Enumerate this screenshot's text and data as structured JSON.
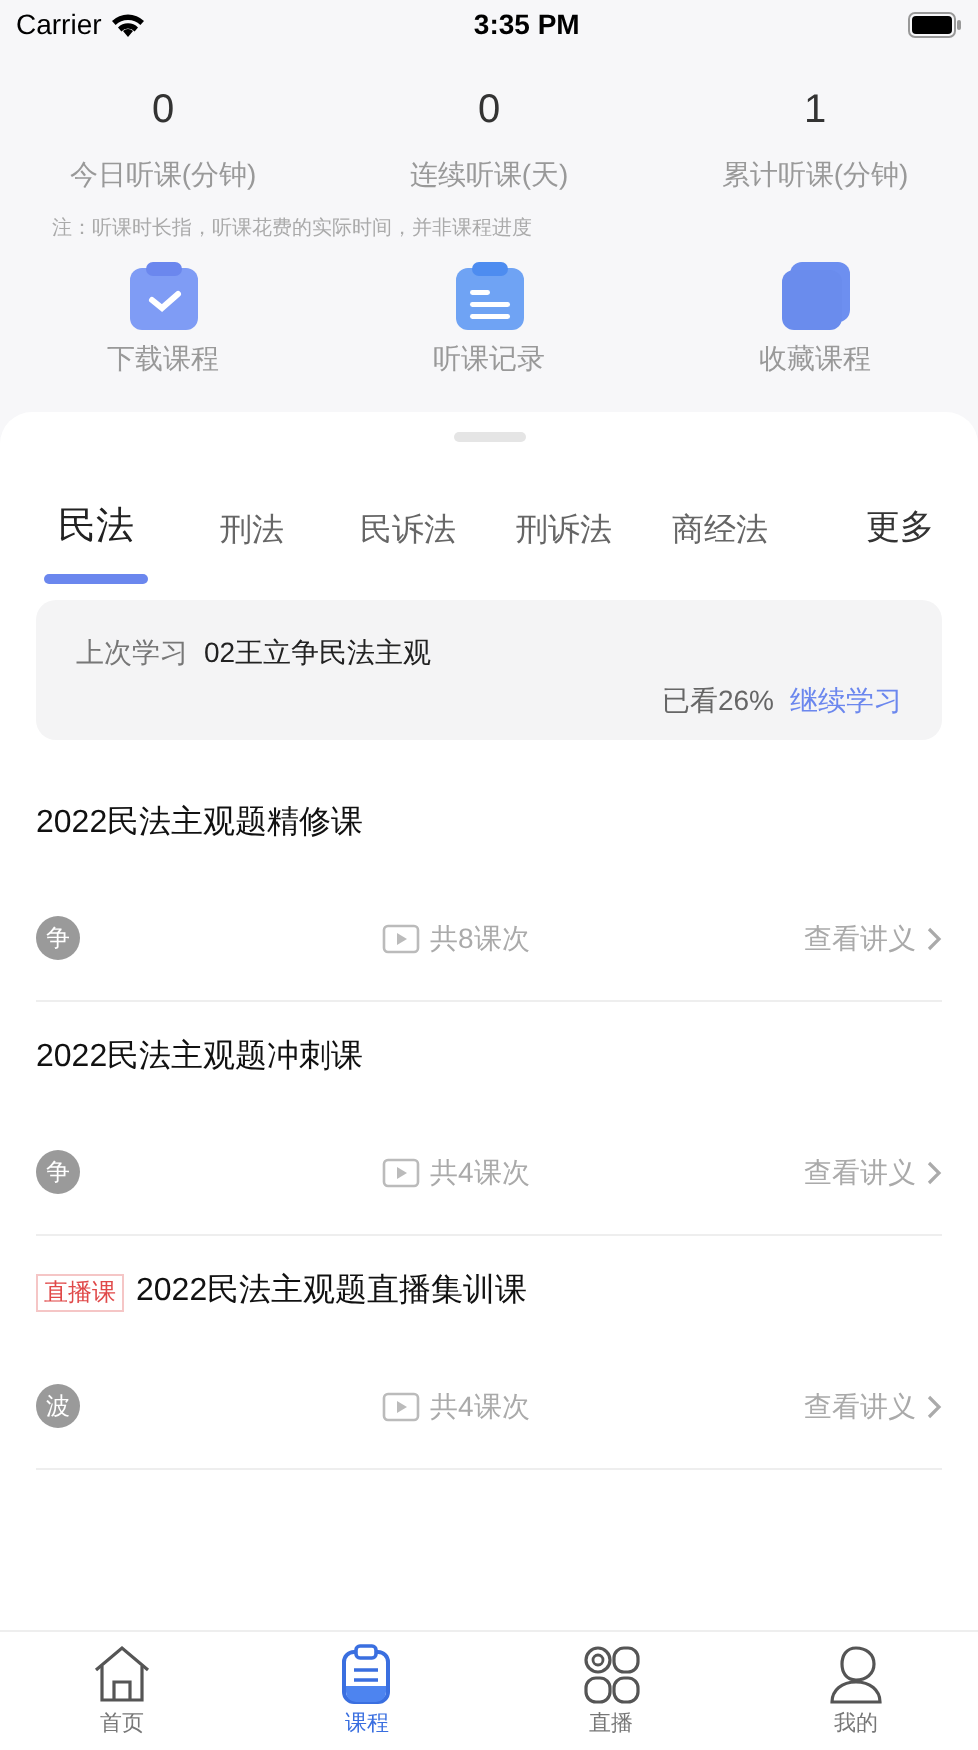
{
  "status_bar": {
    "carrier": "Carrier",
    "time": "3:35 PM"
  },
  "stats": [
    {
      "value": "0",
      "label": "今日听课(分钟)"
    },
    {
      "value": "0",
      "label": "连续听课(天)"
    },
    {
      "value": "1",
      "label": "累计听课(分钟)"
    }
  ],
  "note": "注：听课时长指，听课花费的实际时间，并非课程进度",
  "shortcuts": [
    {
      "kind": "download",
      "label": "下载课程"
    },
    {
      "kind": "history",
      "label": "听课记录"
    },
    {
      "kind": "favorites",
      "label": "收藏课程"
    }
  ],
  "tabs": [
    {
      "label": "民法",
      "selected": true
    },
    {
      "label": "刑法",
      "selected": false
    },
    {
      "label": "民诉法",
      "selected": false
    },
    {
      "label": "刑诉法",
      "selected": false
    },
    {
      "label": "商经法",
      "selected": false
    }
  ],
  "more": "更多",
  "last_study": {
    "label": "上次学习",
    "course": "02王立争民法主观",
    "progress": "已看26%",
    "action": "继续学习"
  },
  "courses": [
    {
      "title": "2022民法主观题精修课",
      "teacher": "争",
      "lessons": "共8课次",
      "notes": "查看讲义"
    },
    {
      "title": "2022民法主观题冲刺课",
      "teacher": "争",
      "lessons": "共4课次",
      "notes": "查看讲义"
    },
    {
      "badge": "直播课",
      "title": "2022民法主观题直播集训课",
      "teacher": "波",
      "lessons": "共4课次",
      "notes": "查看讲义"
    }
  ],
  "bottom_nav": [
    {
      "kind": "home",
      "label": "首页",
      "selected": false
    },
    {
      "kind": "course",
      "label": "课程",
      "selected": true
    },
    {
      "kind": "live",
      "label": "直播",
      "selected": false
    },
    {
      "kind": "profile",
      "label": "我的",
      "selected": false
    }
  ]
}
